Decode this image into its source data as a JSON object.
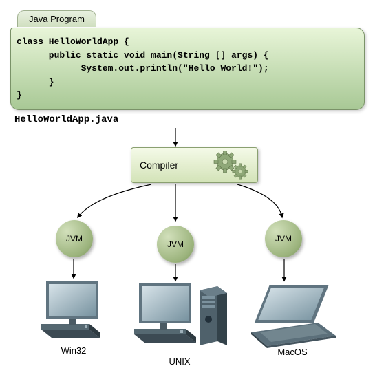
{
  "tab_label": "Java Program",
  "code": "class HelloWorldApp {\n      public static void main(String [] args) {\n            System.out.println(\"Hello World!\");\n      }\n}",
  "filename": "HelloWorldApp.java",
  "compiler_label": "Compiler",
  "jvm_label": "JVM",
  "platforms": {
    "win32": "Win32",
    "unix": "UNIX",
    "macos": "MacOS"
  }
}
